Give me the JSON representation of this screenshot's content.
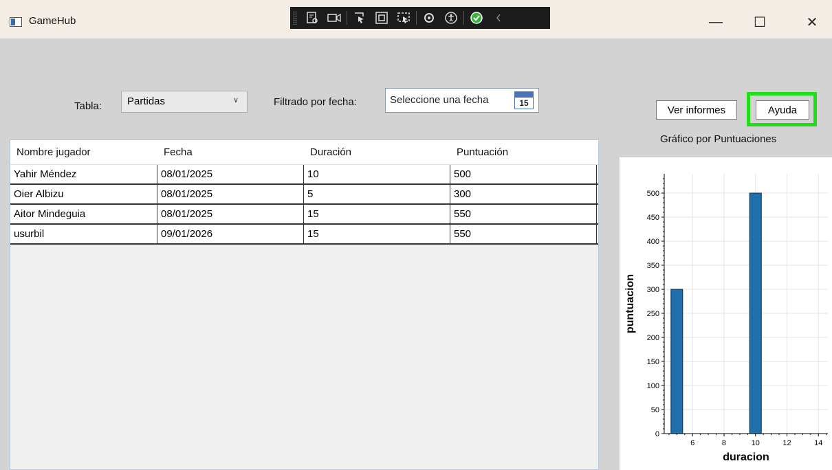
{
  "window": {
    "title": "GameHub",
    "controls": {
      "minimize": "—",
      "maximize": "☐",
      "close": "✕"
    }
  },
  "dev_toolbar": {
    "icons": [
      "live-visual-tree-icon",
      "record-icon",
      "select-element-icon",
      "display-layout-adorners-icon",
      "track-focus-icon",
      "hot-reload-icon",
      "accessibility-icon",
      "binding-check-icon",
      "collapse-chevron-icon"
    ]
  },
  "filters": {
    "table_label": "Tabla:",
    "table_value": "Partidas",
    "date_label": "Filtrado por fecha:",
    "date_placeholder": "Seleccione una fecha",
    "calendar_day": "15"
  },
  "buttons": {
    "reports": "Ver informes",
    "help": "Ayuda"
  },
  "colors": {
    "accent_highlight": "#22dd1a",
    "bar": "#1f6fad"
  },
  "grid": {
    "columns": [
      "Nombre jugador",
      "Fecha",
      "Duración",
      "Puntuación"
    ],
    "rows": [
      [
        "Yahir Méndez",
        "08/01/2025",
        "10",
        "500"
      ],
      [
        "Oier Albizu",
        "08/01/2025",
        "5",
        "300"
      ],
      [
        "Aitor Mindeguia",
        "08/01/2025",
        "15",
        "550"
      ],
      [
        "usurbil",
        "09/01/2026",
        "15",
        "550"
      ]
    ]
  },
  "chart_title": "Gráfico por Puntuaciones",
  "chart_data": {
    "type": "bar",
    "title": "",
    "xlabel": "duracion",
    "ylabel": "puntuacion",
    "x": [
      5,
      10
    ],
    "values": [
      300,
      500
    ],
    "xlim": [
      4.2,
      14.6
    ],
    "ylim": [
      0,
      540
    ],
    "xticks": [
      6,
      8,
      10,
      12,
      14
    ],
    "yticks": [
      0,
      50,
      100,
      150,
      200,
      250,
      300,
      350,
      400,
      450,
      500
    ],
    "grid": true
  }
}
